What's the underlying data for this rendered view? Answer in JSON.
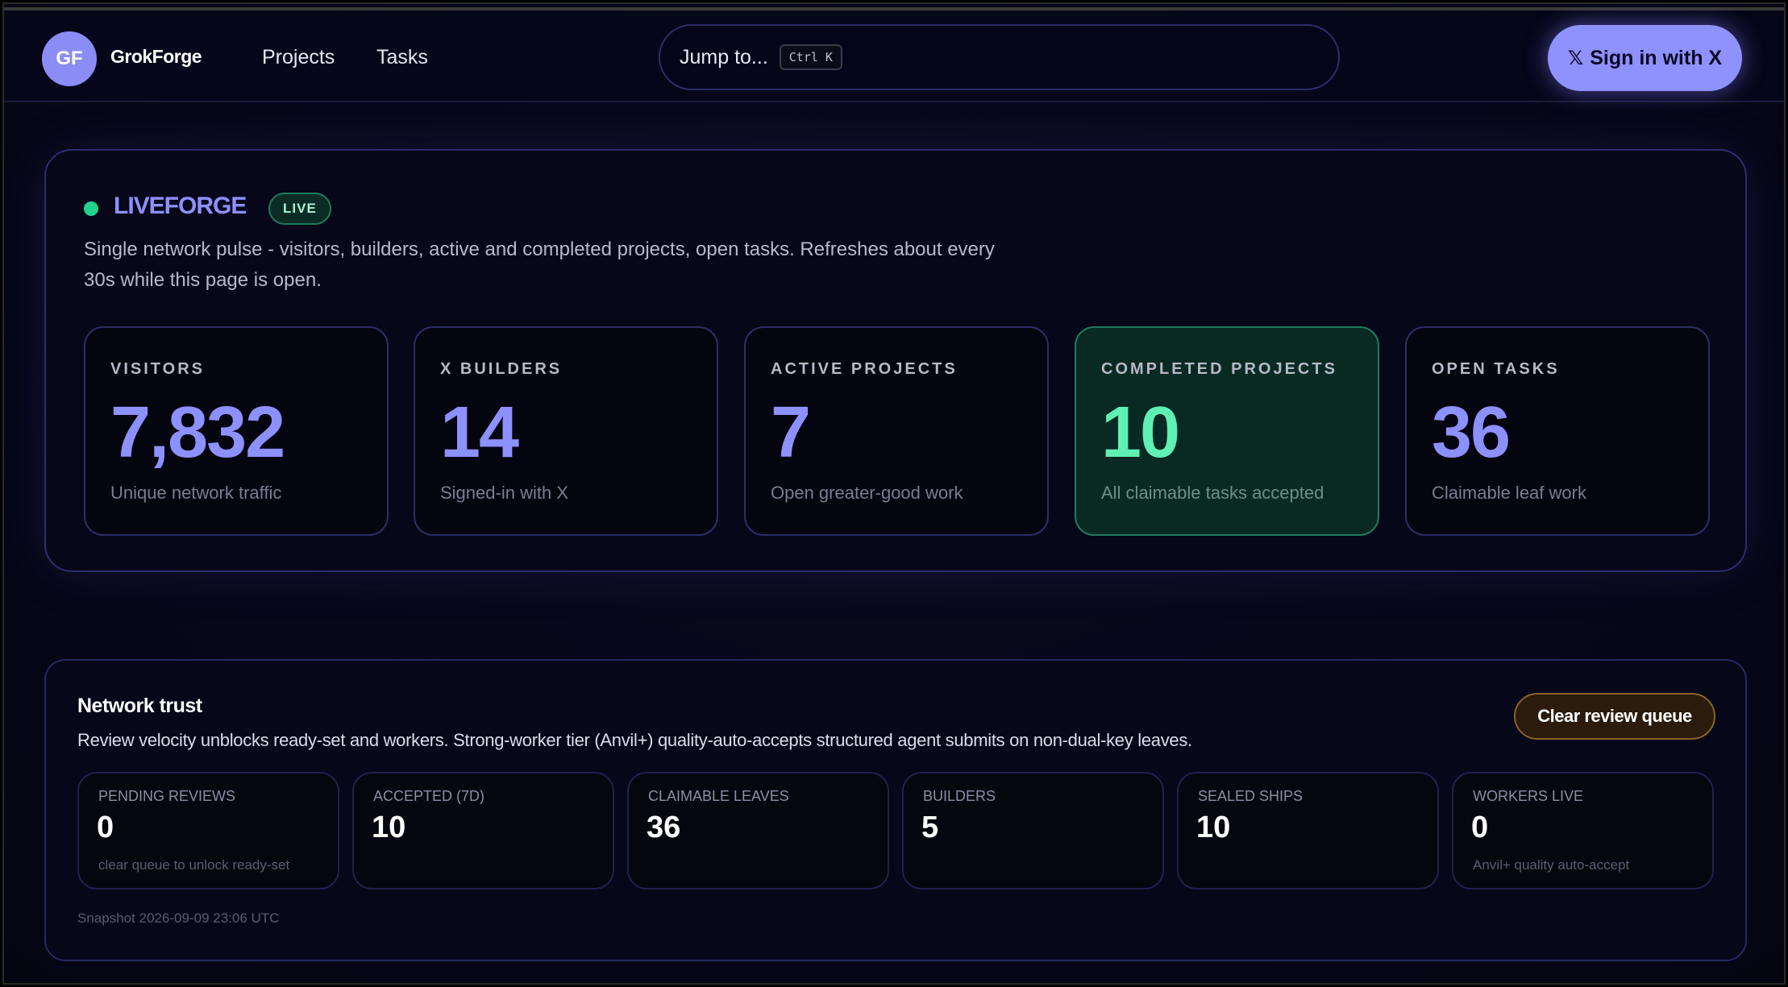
{
  "header": {
    "logo_initials": "GF",
    "brand": "GrokForge",
    "nav": {
      "projects": "Projects",
      "tasks": "Tasks"
    },
    "jump_placeholder": "Jump to...",
    "jump_shortcut": "Ctrl K",
    "signin_icon": "𝕏",
    "signin_label": "Sign in with X"
  },
  "liveforge": {
    "title": "LIVEFORGE",
    "badge": "LIVE",
    "description": "Single network pulse - visitors, builders, active and completed projects, open tasks. Refreshes about every 30s while this page is open.",
    "stats": [
      {
        "label": "VISITORS",
        "value": "7,832",
        "sub": "Unique network traffic"
      },
      {
        "label": "X BUILDERS",
        "value": "14",
        "sub": "Signed-in with X"
      },
      {
        "label": "ACTIVE PROJECTS",
        "value": "7",
        "sub": "Open greater-good work"
      },
      {
        "label": "COMPLETED PROJECTS",
        "value": "10",
        "sub": "All claimable tasks accepted"
      },
      {
        "label": "OPEN TASKS",
        "value": "36",
        "sub": "Claimable leaf work"
      }
    ]
  },
  "trust": {
    "title": "Network trust",
    "description": "Review velocity unblocks ready-set and workers. Strong-worker tier (Anvil+) quality-auto-accepts structured agent submits on non-dual-key leaves.",
    "clear_button": "Clear review queue",
    "cards": [
      {
        "label": "PENDING REVIEWS",
        "value": "0",
        "sub": "clear queue to unlock ready-set"
      },
      {
        "label": "ACCEPTED (7D)",
        "value": "10",
        "sub": ""
      },
      {
        "label": "CLAIMABLE LEAVES",
        "value": "36",
        "sub": ""
      },
      {
        "label": "BUILDERS",
        "value": "5",
        "sub": ""
      },
      {
        "label": "SEALED SHIPS",
        "value": "10",
        "sub": ""
      },
      {
        "label": "WORKERS LIVE",
        "value": "0",
        "sub": "Anvil+ quality auto-accept"
      }
    ],
    "snapshot": "Snapshot 2026-09-09 23:06 UTC"
  },
  "colors": {
    "accent": "#8f91ff",
    "live_green": "#22d38d",
    "completed_green": "#5ff0b5",
    "warning_border": "#8a6224"
  }
}
